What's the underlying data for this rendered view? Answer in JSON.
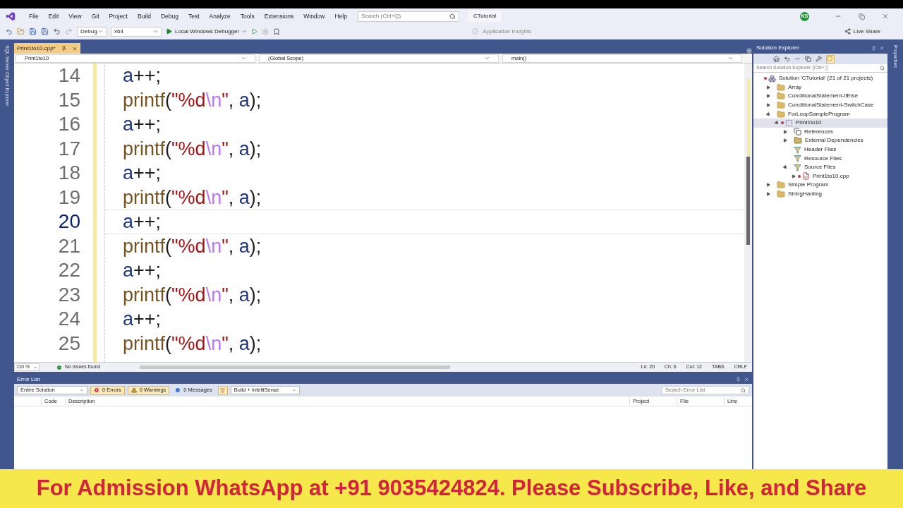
{
  "menu": {
    "items": [
      "File",
      "Edit",
      "View",
      "Git",
      "Project",
      "Build",
      "Debug",
      "Test",
      "Analyze",
      "Tools",
      "Extensions",
      "Window",
      "Help"
    ],
    "search_placeholder": "Search (Ctrl+Q)",
    "solution_name": "CTutorial",
    "avatar": "KS"
  },
  "toolbar": {
    "configuration": "Debug",
    "platform": "x64",
    "run": "Local Windows Debugger",
    "insights": "Application Insights",
    "live_share": "Live Share"
  },
  "left_strip": "SQL Server Object Explorer",
  "editor": {
    "tabs": [
      {
        "label": "Print1to10.cpp*",
        "selected": true
      }
    ],
    "nav": [
      "Print1to10",
      "(Global Scope)",
      "main()"
    ],
    "lines": [
      {
        "number": "14",
        "current": false,
        "code": [
          {
            "text": "a",
            "kind": "var"
          },
          {
            "text": "++;",
            "kind": "plain"
          }
        ]
      },
      {
        "number": "15",
        "current": false,
        "code": [
          {
            "text": "printf",
            "kind": "func"
          },
          {
            "text": "(",
            "kind": "plain"
          },
          {
            "text": "\"%d",
            "kind": "string"
          },
          {
            "text": "\\n",
            "kind": "escape"
          },
          {
            "text": "\"",
            "kind": "string"
          },
          {
            "text": ", ",
            "kind": "plain"
          },
          {
            "text": "a",
            "kind": "var"
          },
          {
            "text": ");",
            "kind": "plain"
          }
        ]
      },
      {
        "number": "16",
        "current": false,
        "code": [
          {
            "text": "a",
            "kind": "var"
          },
          {
            "text": "++;",
            "kind": "plain"
          }
        ]
      },
      {
        "number": "17",
        "current": false,
        "code": [
          {
            "text": "printf",
            "kind": "func"
          },
          {
            "text": "(",
            "kind": "plain"
          },
          {
            "text": "\"%d",
            "kind": "string"
          },
          {
            "text": "\\n",
            "kind": "escape"
          },
          {
            "text": "\"",
            "kind": "string"
          },
          {
            "text": ", ",
            "kind": "plain"
          },
          {
            "text": "a",
            "kind": "var"
          },
          {
            "text": ");",
            "kind": "plain"
          }
        ]
      },
      {
        "number": "18",
        "current": false,
        "code": [
          {
            "text": "a",
            "kind": "var"
          },
          {
            "text": "++;",
            "kind": "plain"
          }
        ]
      },
      {
        "number": "19",
        "current": false,
        "code": [
          {
            "text": "printf",
            "kind": "func"
          },
          {
            "text": "(",
            "kind": "plain"
          },
          {
            "text": "\"%d",
            "kind": "string"
          },
          {
            "text": "\\n",
            "kind": "escape"
          },
          {
            "text": "\"",
            "kind": "string"
          },
          {
            "text": ", ",
            "kind": "plain"
          },
          {
            "text": "a",
            "kind": "var"
          },
          {
            "text": ");",
            "kind": "plain"
          }
        ]
      },
      {
        "number": "20",
        "current": true,
        "code": [
          {
            "text": "a",
            "kind": "var"
          },
          {
            "text": "++;",
            "kind": "plain"
          }
        ]
      },
      {
        "number": "21",
        "current": false,
        "code": [
          {
            "text": "printf",
            "kind": "func"
          },
          {
            "text": "(",
            "kind": "plain"
          },
          {
            "text": "\"%d",
            "kind": "string"
          },
          {
            "text": "\\n",
            "kind": "escape"
          },
          {
            "text": "\"",
            "kind": "string"
          },
          {
            "text": ", ",
            "kind": "plain"
          },
          {
            "text": "a",
            "kind": "var"
          },
          {
            "text": ");",
            "kind": "plain"
          }
        ]
      },
      {
        "number": "22",
        "current": false,
        "code": [
          {
            "text": "a",
            "kind": "var"
          },
          {
            "text": "++;",
            "kind": "plain"
          }
        ]
      },
      {
        "number": "23",
        "current": false,
        "code": [
          {
            "text": "printf",
            "kind": "func"
          },
          {
            "text": "(",
            "kind": "plain"
          },
          {
            "text": "\"%d",
            "kind": "string"
          },
          {
            "text": "\\n",
            "kind": "escape"
          },
          {
            "text": "\"",
            "kind": "string"
          },
          {
            "text": ", ",
            "kind": "plain"
          },
          {
            "text": "a",
            "kind": "var"
          },
          {
            "text": ");",
            "kind": "plain"
          }
        ]
      },
      {
        "number": "24",
        "current": false,
        "code": [
          {
            "text": "a",
            "kind": "var"
          },
          {
            "text": "++;",
            "kind": "plain"
          }
        ]
      },
      {
        "number": "25",
        "current": false,
        "code": [
          {
            "text": "printf",
            "kind": "func"
          },
          {
            "text": "(",
            "kind": "plain"
          },
          {
            "text": "\"%d",
            "kind": "string"
          },
          {
            "text": "\\n",
            "kind": "escape"
          },
          {
            "text": "\"",
            "kind": "string"
          },
          {
            "text": ", ",
            "kind": "plain"
          },
          {
            "text": "a",
            "kind": "var"
          },
          {
            "text": ");",
            "kind": "plain"
          }
        ]
      }
    ]
  },
  "status_bar": {
    "zoom": "110 %",
    "issues": "No issues found",
    "items": [
      "Ln: 20",
      "Ch: 6",
      "Col: 12",
      "TABS",
      "CRLF"
    ]
  },
  "error_list": {
    "title": "Error List",
    "scope": "Entire Solution",
    "errors": "0 Errors",
    "warnings": "0 Warnings",
    "messages": "0 Messages",
    "source": "Build + IntelliSense",
    "search_placeholder": "Search Error List",
    "columns": [
      "Code",
      "Description",
      "Project",
      "File",
      "Line"
    ]
  },
  "solution_explorer": {
    "title": "Solution Explorer",
    "search_placeholder": "Search Solution Explorer (Ctrl+;)",
    "tree": [
      {
        "label": "Solution 'CTutorial' (21 of 21 projects)",
        "kind": "solution",
        "dot": true,
        "selected": false,
        "children": [
          {
            "label": "Array",
            "kind": "folder",
            "expanded": false,
            "dot": false,
            "selected": false
          },
          {
            "label": "ConditionalStatement-IfElse",
            "kind": "folder",
            "expanded": false,
            "dot": false,
            "selected": false
          },
          {
            "label": "ConditionalStatement-SwitchCase",
            "kind": "folder",
            "expanded": false,
            "dot": false,
            "selected": false
          },
          {
            "label": "ForLoopSampleProgram",
            "kind": "folder",
            "expanded": true,
            "dot": false,
            "selected": false,
            "children": [
              {
                "label": "Print1to10",
                "kind": "project",
                "expanded": true,
                "dot": true,
                "selected": true,
                "children": [
                  {
                    "label": "References",
                    "kind": "references",
                    "expanded": false,
                    "dot": false,
                    "selected": false
                  },
                  {
                    "label": "External Dependencies",
                    "kind": "external",
                    "expanded": false,
                    "dot": false,
                    "selected": false
                  },
                  {
                    "label": "Header Files",
                    "kind": "filter",
                    "dot": false,
                    "selected": false
                  },
                  {
                    "label": "Resource Files",
                    "kind": "filter",
                    "dot": false,
                    "selected": false
                  },
                  {
                    "label": "Source Files",
                    "kind": "filter",
                    "expanded": true,
                    "dot": false,
                    "selected": false,
                    "children": [
                      {
                        "label": "Print1to10.cpp",
                        "kind": "cpp",
                        "expanded": false,
                        "dot": true,
                        "selected": false
                      }
                    ]
                  }
                ]
              }
            ]
          },
          {
            "label": "Simple Program",
            "kind": "folder",
            "expanded": false,
            "dot": false,
            "selected": false
          },
          {
            "label": "StringHanling",
            "kind": "folder",
            "expanded": false,
            "dot": false,
            "selected": false
          }
        ]
      }
    ]
  },
  "right_strip": "Properties",
  "banner": "For Admission WhatsApp at +91 9035424824. Please Subscribe, Like, and Share"
}
